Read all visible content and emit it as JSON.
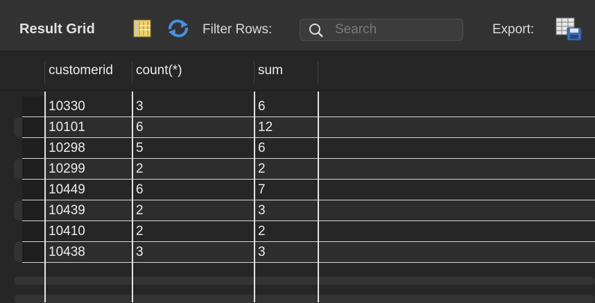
{
  "toolbar": {
    "title": "Result Grid",
    "filter_label": "Filter Rows:",
    "search_placeholder": "Search",
    "export_label": "Export:",
    "icons": [
      "grid-layout-icon",
      "refresh-icon",
      "search-icon",
      "export-table-icon"
    ]
  },
  "grid": {
    "columns": [
      "customerid",
      "count(*)",
      "sum"
    ],
    "rows": [
      [
        "10330",
        "3",
        "6"
      ],
      [
        "10101",
        "6",
        "12"
      ],
      [
        "10298",
        "5",
        "6"
      ],
      [
        "10299",
        "2",
        "2"
      ],
      [
        "10449",
        "6",
        "7"
      ],
      [
        "10439",
        "2",
        "3"
      ],
      [
        "10410",
        "2",
        "2"
      ],
      [
        "10438",
        "3",
        "3"
      ]
    ]
  },
  "colors": {
    "background": "#262626",
    "toolbar": "#323232",
    "grid_line": "#e6e6e6",
    "refresh_accent": "#4a8fe0"
  }
}
